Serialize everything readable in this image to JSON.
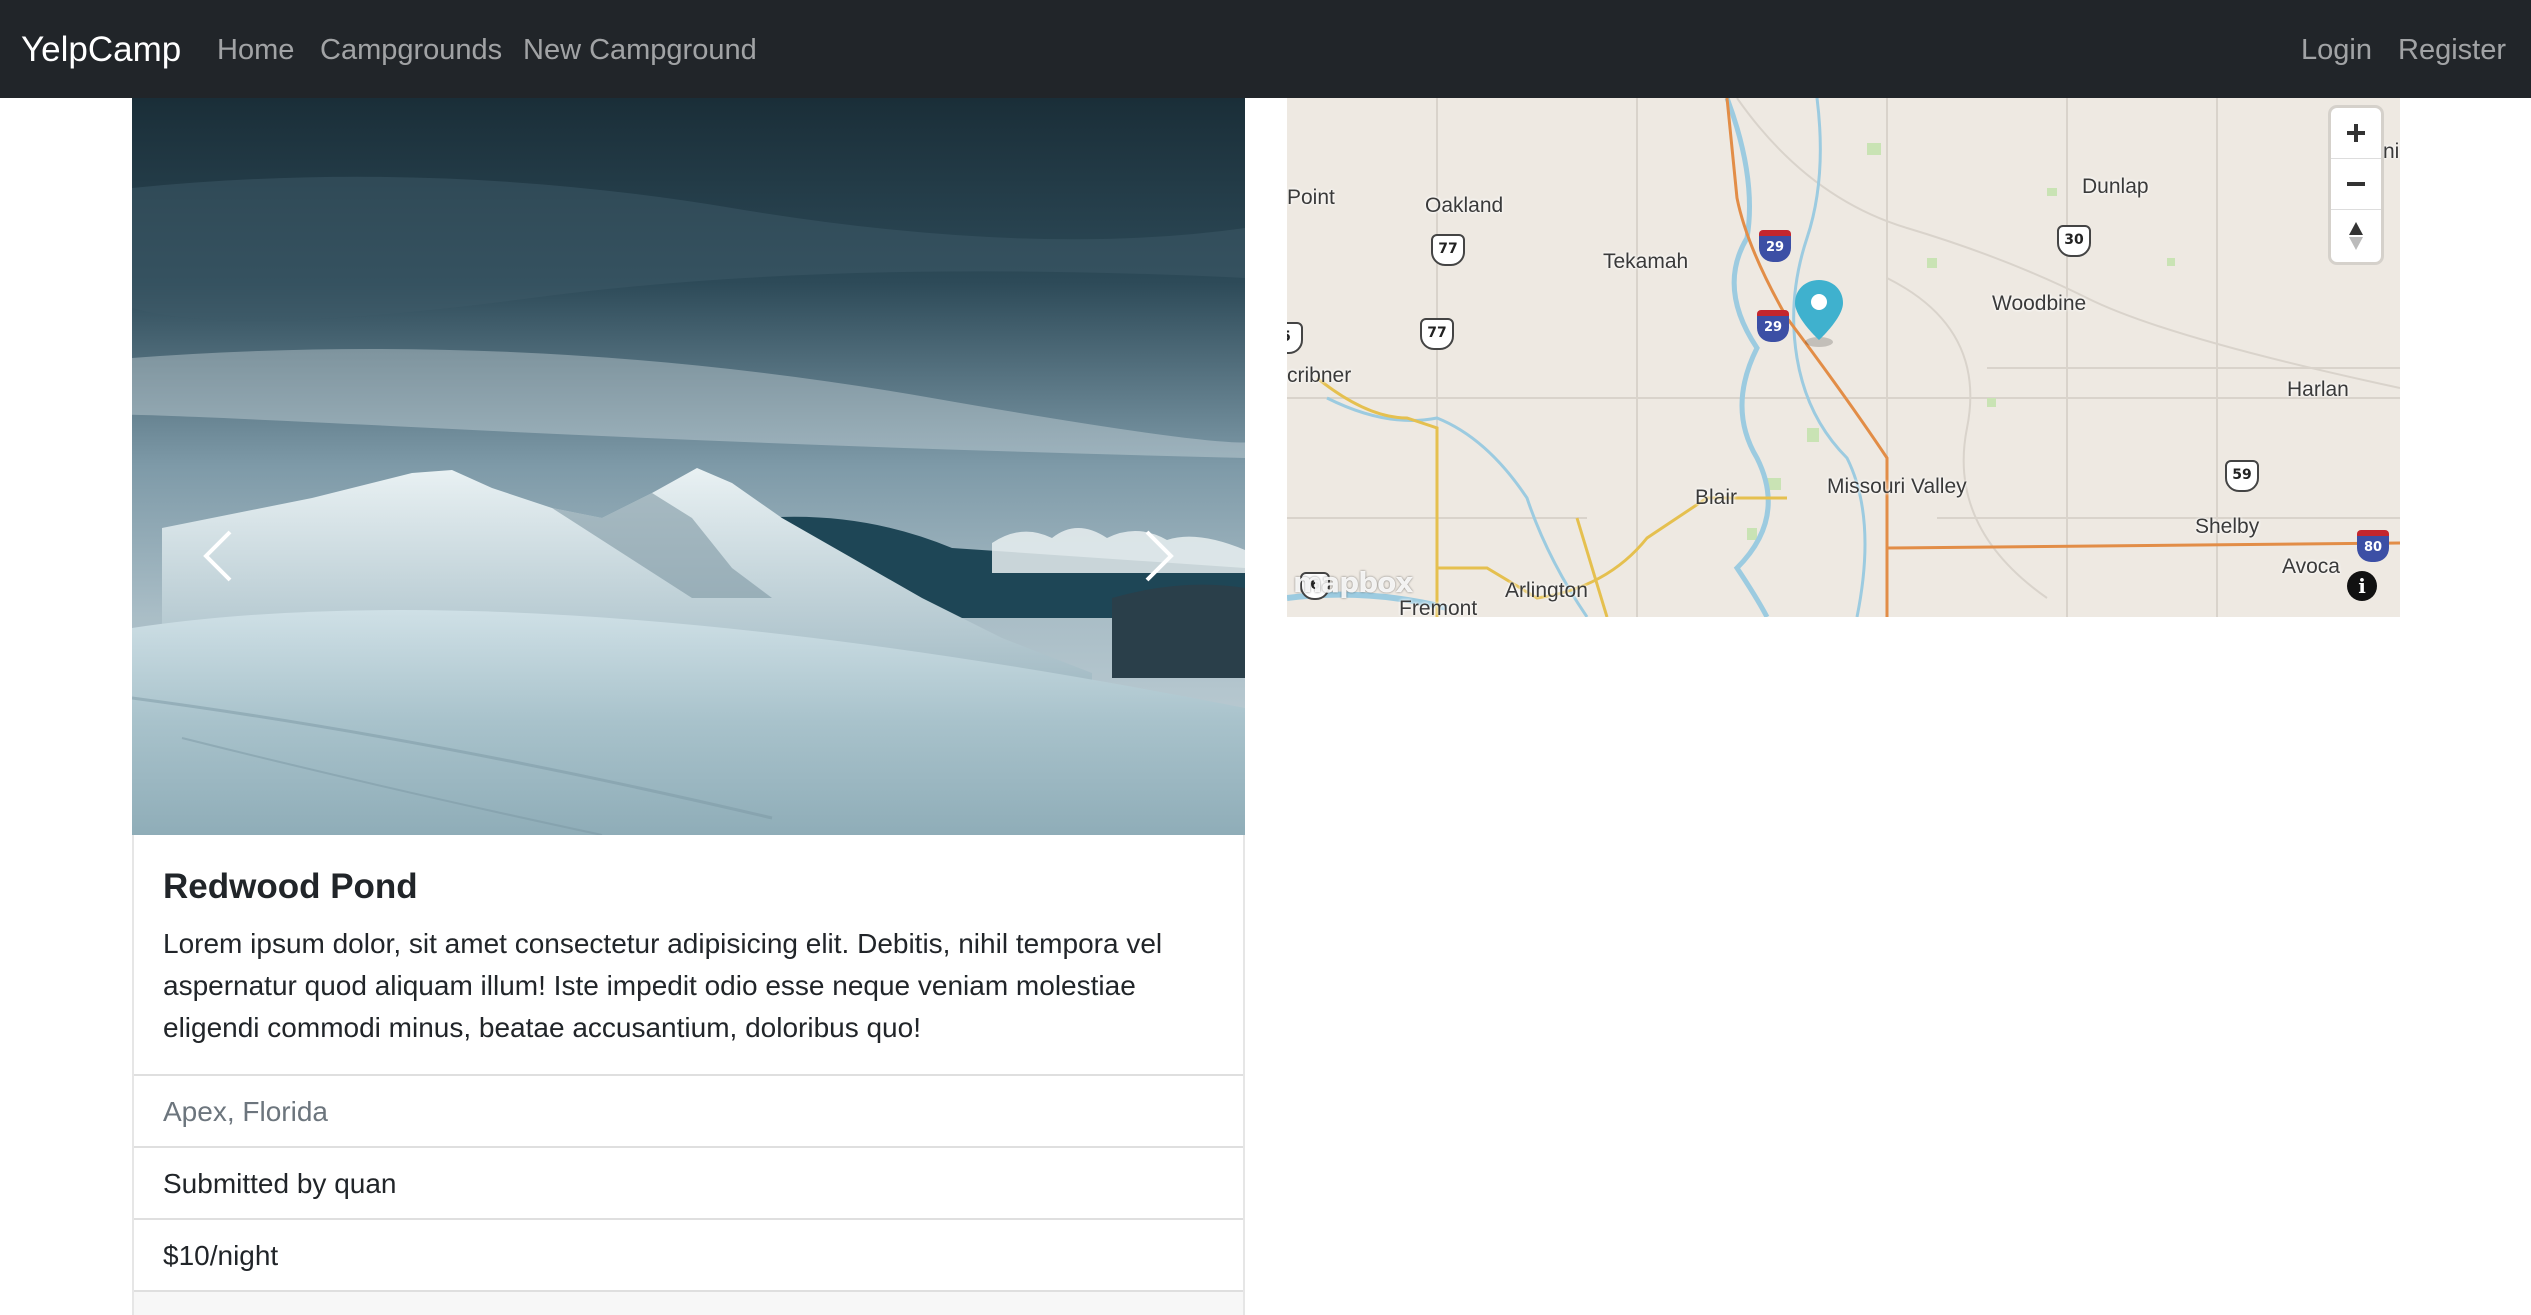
{
  "navbar": {
    "brand": "YelpCamp",
    "links": {
      "home": "Home",
      "campgrounds": "Campgrounds",
      "new_campground": "New Campground"
    },
    "auth": {
      "login": "Login",
      "register": "Register"
    },
    "background": "#212529"
  },
  "carousel": {
    "prev_icon": "chevron-left-icon",
    "next_icon": "chevron-right-icon"
  },
  "campground": {
    "title": "Redwood Pond",
    "description": "Lorem ipsum dolor, sit amet consectetur adipisicing elit. Debitis, nihil tempora vel aspernatur quod aliquam illum! Iste impedit odio esse neque veniam molestiae eligendi commodi minus, beatae accusantium, doloribus quo!",
    "location": "Apex, Florida",
    "submitted_by": "Submitted by quan",
    "price": "$10/night"
  },
  "map": {
    "places": {
      "point": "Point",
      "oakland": "Oakland",
      "tekamah": "Tekamah",
      "dunlap": "Dunlap",
      "woodbine": "Woodbine",
      "scribner": "cribner",
      "harlan": "Harlan",
      "blair": "Blair",
      "missouri_valley": "Missouri Valley",
      "shelby": "Shelby",
      "avoca": "Avoca",
      "arlington": "Arlington",
      "fremont": "Fremont",
      "edge_ni": "ni"
    },
    "routes": {
      "us77_a": "77",
      "us77_b": "77",
      "i29_a": "29",
      "i29_b": "29",
      "us30": "30",
      "us59": "59",
      "i80": "80",
      "edge_5": "5",
      "bottom_6": "6"
    },
    "controls": {
      "zoom_in": "+",
      "zoom_out": "−",
      "info": "i"
    },
    "attribution": "mapbox",
    "marker_color": "#3fb1ce"
  }
}
